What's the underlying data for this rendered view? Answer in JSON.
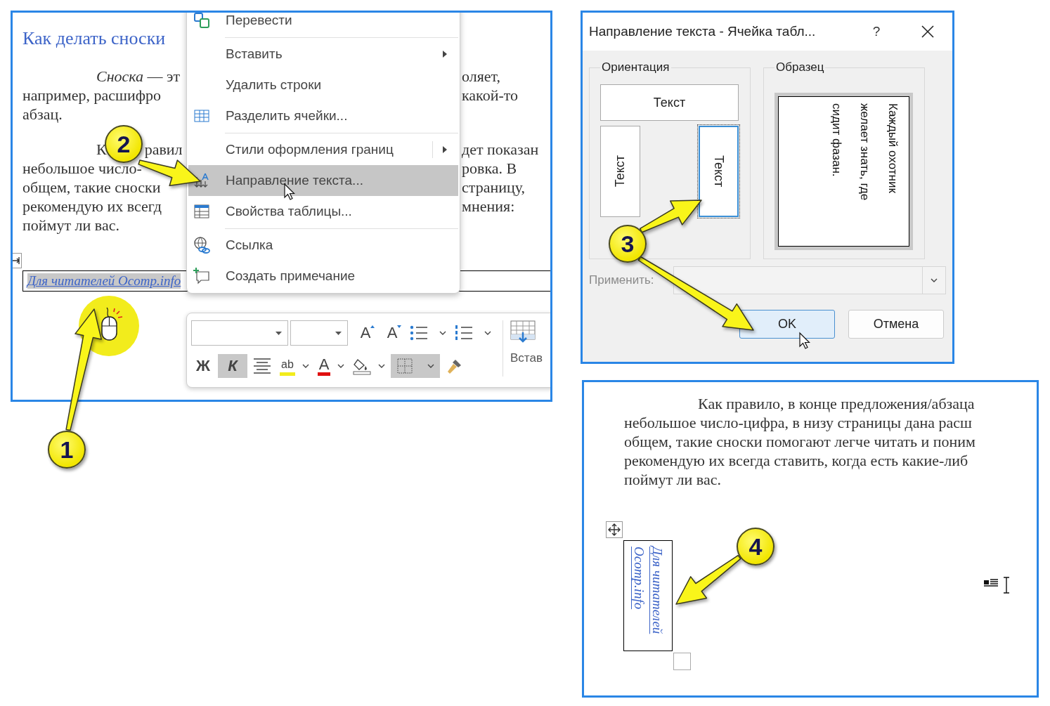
{
  "steps": [
    {
      "number": "1"
    },
    {
      "number": "2"
    },
    {
      "number": "3"
    },
    {
      "number": "4"
    }
  ],
  "document_before": {
    "heading": "Как делать сноски",
    "paragraphs": [
      {
        "lines": [
          {
            "left": [
              "*Сноска* — эт"
            ],
            "right": "оляет,"
          },
          {
            "left": [
              "например, расшифро"
            ],
            "right": "какой-то"
          },
          {
            "left": [
              "абзац."
            ]
          }
        ]
      },
      {
        "lines": [
          {
            "left": [
              "К",
              "равил"
            ],
            "right": "дет показан"
          },
          {
            "left": [
              "небольшое число-"
            ],
            "right": "ровка. В"
          },
          {
            "left": [
              "общем, такие сноски"
            ],
            "right": "страницу,"
          },
          {
            "left": [
              "рекомендую их всегд"
            ],
            "right": "мнения:"
          },
          {
            "left": [
              "поймут ли вас."
            ]
          }
        ]
      }
    ],
    "footnote_cell": {
      "text": "Для читателей Ocomp.info",
      "selected": true
    }
  },
  "context_menu": {
    "groups": [
      [
        {
          "label": "Перевести",
          "kind": "translate",
          "submenu": false,
          "split": false,
          "selected": false
        }
      ],
      [
        {
          "label": "Вставить",
          "kind": "plain",
          "submenu": true,
          "split": false,
          "selected": false
        },
        {
          "label": "Удалить строки",
          "kind": "plain",
          "submenu": false,
          "split": false,
          "selected": false
        },
        {
          "label": "Разделить ячейки...",
          "kind": "split-cells",
          "submenu": false,
          "split": false,
          "selected": false
        }
      ],
      [
        {
          "label": "Стили оформления границ",
          "kind": "plain",
          "submenu": true,
          "split": true,
          "selected": false
        },
        {
          "label": "Направление текста...",
          "kind": "direction",
          "submenu": false,
          "split": false,
          "selected": true
        },
        {
          "label": "Свойства таблицы...",
          "kind": "table",
          "submenu": false,
          "split": false,
          "selected": false
        }
      ],
      [
        {
          "label": "Ссылка",
          "kind": "link",
          "submenu": false,
          "split": false,
          "selected": false
        },
        {
          "label": "Создать примечание",
          "kind": "comment",
          "submenu": false,
          "split": false,
          "selected": false
        }
      ]
    ]
  },
  "mini_toolbar": {
    "fields": [
      {
        "kind": "font-name"
      },
      {
        "kind": "font-size"
      }
    ],
    "rows": [
      [
        {
          "kind": "grow",
          "label": "A",
          "selected": false
        },
        {
          "kind": "shrink",
          "label": "A",
          "selected": false
        },
        {
          "kind": "bullets",
          "dropdown": true,
          "selected": false
        },
        {
          "kind": "numbering",
          "dropdown": true,
          "selected": false
        }
      ],
      [
        {
          "kind": "bold",
          "label": "Ж",
          "selected": false
        },
        {
          "kind": "italic",
          "label": "К",
          "selected": true
        },
        {
          "kind": "align",
          "selected": false
        },
        {
          "kind": "highlight",
          "label": "ab",
          "dropdown": true,
          "selected": false
        },
        {
          "kind": "font-color",
          "label": "A",
          "dropdown": true,
          "selected": false
        },
        {
          "kind": "shading",
          "dropdown": true,
          "selected": false
        },
        {
          "kind": "borders",
          "dropdown": true,
          "selected": true
        },
        {
          "kind": "painter",
          "selected": false
        }
      ]
    ],
    "insert": {
      "label": "Встав"
    }
  },
  "dialog": {
    "title": "Направление текста - Ячейка табл...",
    "help": "?",
    "orientation": {
      "label": "Ориентация",
      "options": [
        {
          "kind": "horizontal",
          "label": "Текст",
          "selected": false
        },
        {
          "kind": "up",
          "label": "Текст",
          "selected": false
        },
        {
          "kind": "down",
          "label": "Текст",
          "selected": true
        }
      ]
    },
    "sample": {
      "label": "Образец",
      "text": "Каждый охотник желает знать, где сидит фазан."
    },
    "apply": {
      "label": "Применить:",
      "disabled": true
    },
    "buttons": [
      {
        "label": "OK",
        "kind": "default"
      },
      {
        "label": "Отмена",
        "kind": "normal"
      }
    ]
  },
  "document_after": {
    "lines": [
      "Как правило, в конце предложения/абзаца",
      "небольшое число-цифра, в низу страницы дана расш",
      "общем, такие сноски помогают легче читать и поним",
      "рекомендую их всегда ставить, когда есть какие-либ",
      "поймут ли вас."
    ],
    "footnote_cell": {
      "text": "Для читателей Ocomp.info"
    }
  }
}
